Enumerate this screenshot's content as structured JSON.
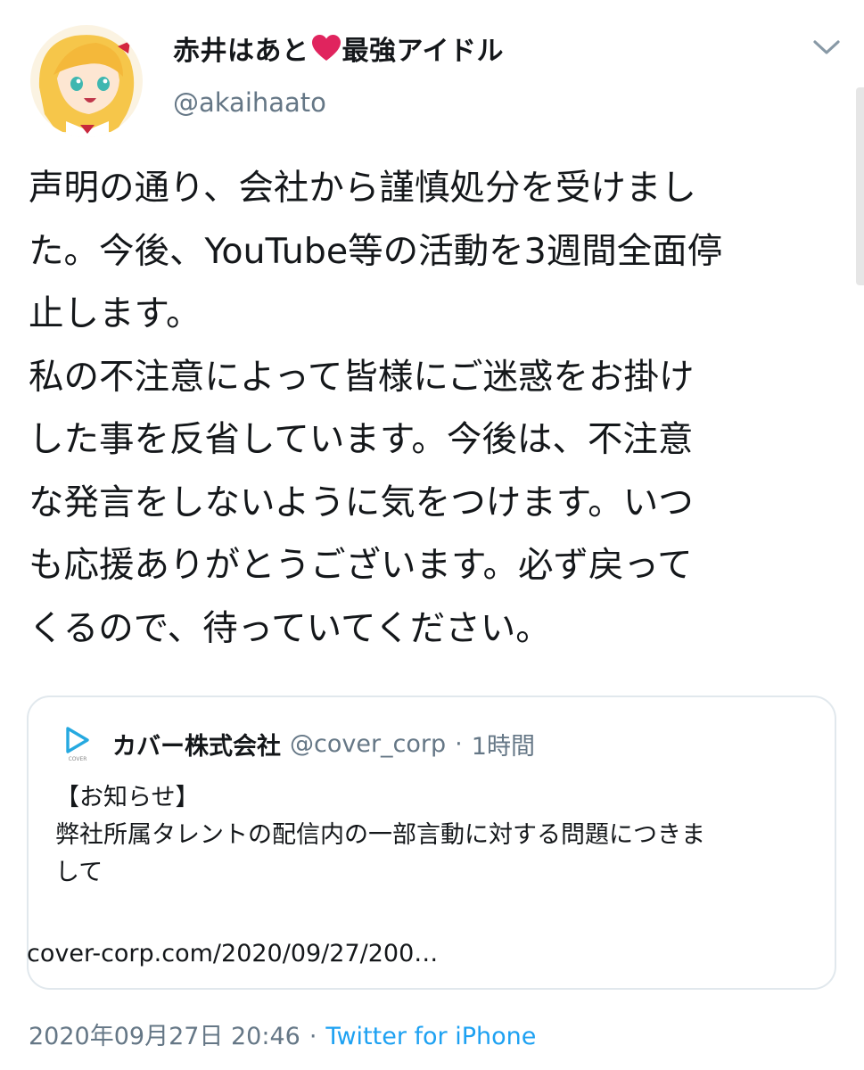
{
  "tweet": {
    "author": {
      "name_part1": "赤井はあと",
      "name_part2": "最強アイドル",
      "handle": "@akaihaato",
      "heart_icon": "heart-icon",
      "avatar_icon": "avatar"
    },
    "menu_icon": "chevron-down-icon",
    "text_lines": [
      "声明の通り、会社から謹慎処分を受けまし",
      "た。今後、YouTube等の活動を3週間全面停",
      "止します。",
      "私の不注意によって皆様にご迷惑をお掛け",
      "した事を反省しています。今後は、不注意",
      "な発言をしないように気をつけます。いつ",
      "も応援ありがとうございます。必ず戻って",
      "くるので、待っていてください。"
    ],
    "quote": {
      "logo_icon": "cover-logo-icon",
      "logo_text": "COVER",
      "name": "カバー株式会社",
      "handle": "@cover_corp",
      "separator": "·",
      "time": "1時間",
      "body_lines": [
        "【お知らせ】",
        "弊社所属タレントの配信内の一部言動に対する問題につきま",
        "して"
      ],
      "link": "cover-corp.com/2020/09/27/200…"
    },
    "timestamp": "2020年09月27日 20:46",
    "separator": "·",
    "source": "Twitter for iPhone"
  },
  "colors": {
    "text": "#14171a",
    "secondary": "#657786",
    "link": "#1da1f2",
    "heart": "#e0245e",
    "border": "#e1e8ed"
  }
}
